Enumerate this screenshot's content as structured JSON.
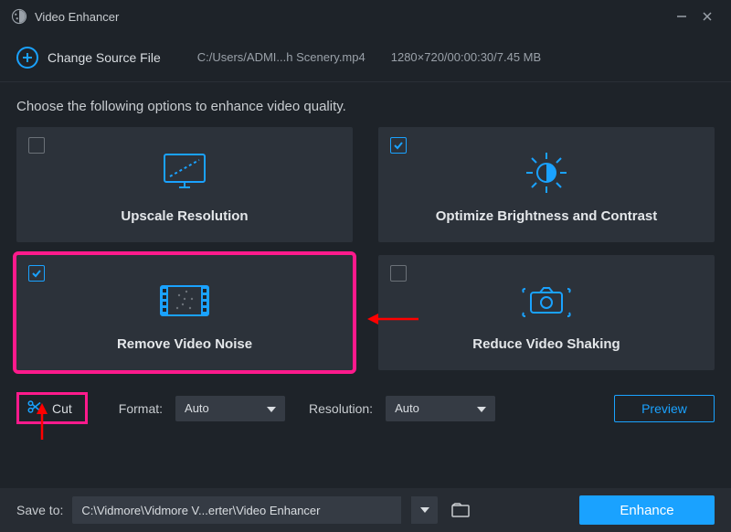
{
  "titlebar": {
    "title": "Video Enhancer"
  },
  "source": {
    "change_label": "Change Source File",
    "path": "C:/Users/ADMI...h Scenery.mp4",
    "meta": "1280×720/00:00:30/7.45 MB"
  },
  "instruction": "Choose the following options to enhance video quality.",
  "cards": {
    "upscale": {
      "label": "Upscale Resolution",
      "checked": false
    },
    "brightness": {
      "label": "Optimize Brightness and Contrast",
      "checked": true
    },
    "noise": {
      "label": "Remove Video Noise",
      "checked": true
    },
    "shaking": {
      "label": "Reduce Video Shaking",
      "checked": false
    }
  },
  "controls": {
    "cut_label": "Cut",
    "format_label": "Format:",
    "format_value": "Auto",
    "resolution_label": "Resolution:",
    "resolution_value": "Auto",
    "preview_label": "Preview"
  },
  "bottom": {
    "save_label": "Save to:",
    "path_value": "C:\\Vidmore\\Vidmore V...erter\\Video Enhancer",
    "enhance_label": "Enhance"
  },
  "colors": {
    "accent": "#1aa2ff",
    "highlight": "#ff1a8c",
    "arrow": "#ff0000"
  }
}
